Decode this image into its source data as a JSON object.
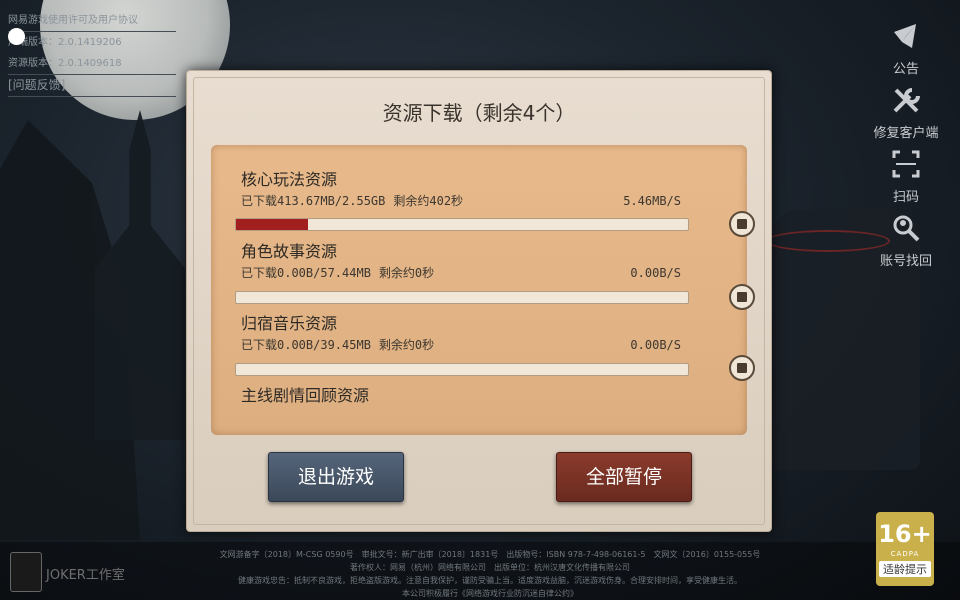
{
  "top_info": {
    "license_link": "网易游戏使用许可及用户协议",
    "client_version": "户端版本：2.0.1419206",
    "resource_version": "资源版本：2.0.1409618",
    "feedback": "[问题反馈]"
  },
  "side_buttons": [
    {
      "label": "公告",
      "icon": "notice-icon"
    },
    {
      "label": "修复客户端",
      "icon": "repair-tools-icon"
    },
    {
      "label": "扫码",
      "icon": "scan-qr-icon"
    },
    {
      "label": "账号找回",
      "icon": "account-search-icon"
    }
  ],
  "panel": {
    "title": "资源下载（剩余4个）",
    "items": [
      {
        "name": "核心玩法资源",
        "downloaded": "已下载413.67MB/2.55GB",
        "remaining": "剩余约402秒",
        "speed": "5.46MB/S",
        "progress": 0.16
      },
      {
        "name": "角色故事资源",
        "downloaded": "已下载0.00B/57.44MB",
        "remaining": "剩余约0秒",
        "speed": "0.00B/S",
        "progress": 0
      },
      {
        "name": "归宿音乐资源",
        "downloaded": "已下载0.00B/39.45MB",
        "remaining": "剩余约0秒",
        "speed": "0.00B/S",
        "progress": 0
      },
      {
        "name": "主线剧情回顾资源"
      }
    ],
    "exit_label": "退出游戏",
    "pause_all_label": "全部暂停"
  },
  "footer": {
    "line1": "文网游备字〔2018〕M-CSG 0590号　审批文号：新广出审〔2018〕1831号　出版物号：ISBN 978-7-498-06161-5　文网文〔2016〕0155-055号",
    "line2": "著作权人：网易（杭州）网络有限公司　出版单位：杭州汉唐文化传播有限公司",
    "line3": "健康游戏忠告：抵制不良游戏，拒绝盗版游戏。注意自我保护，谨防受骗上当。适度游戏益脑，沉迷游戏伤身。合理安排时间，享受健康生活。",
    "line4": "本公司积极履行《网络游戏行业防沉迷自律公约》",
    "studio": "JOKER工作室",
    "age_rating": "16+",
    "age_org": "CADPA",
    "age_tip": "适龄提示"
  }
}
